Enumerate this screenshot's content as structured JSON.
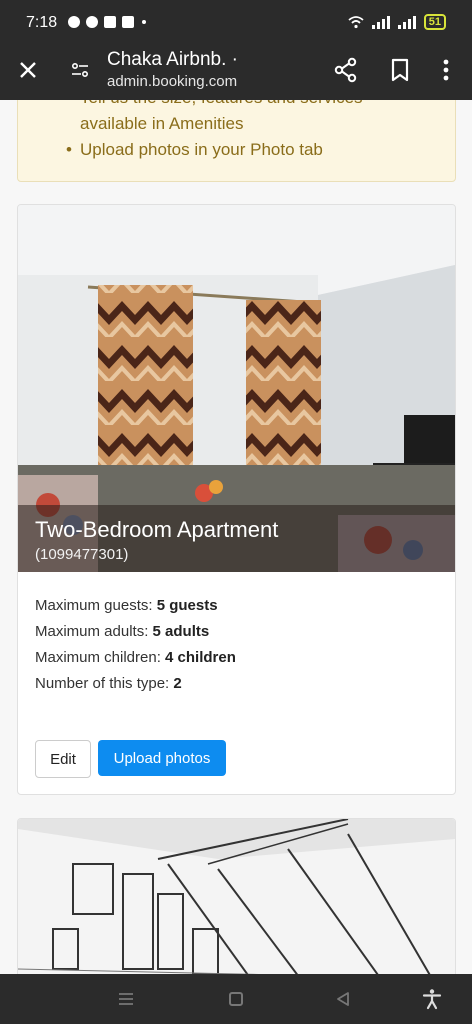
{
  "status_bar": {
    "time": "7:18",
    "battery": "51",
    "notification_icons": [
      "messenger-icon",
      "messenger-icon",
      "calendar-icon",
      "youtube-icon"
    ]
  },
  "browser": {
    "title": "Chaka Airbnb. ·",
    "url": "admin.booking.com"
  },
  "tips": {
    "items": [
      "Tell us the size, features and services",
      "available in Amenities",
      "Upload photos in your Photo tab"
    ]
  },
  "room": {
    "name": "Two-Bedroom Apartment",
    "id": "(1099477301)",
    "specs": [
      {
        "label": "Maximum guests: ",
        "value": "5 guests"
      },
      {
        "label": "Maximum adults: ",
        "value": "5 adults"
      },
      {
        "label": "Maximum children: ",
        "value": "4 children"
      },
      {
        "label": "Number of this type: ",
        "value": "2"
      }
    ],
    "edit_label": "Edit",
    "upload_label": "Upload photos"
  },
  "colors": {
    "primary_button": "#0d8cf0",
    "tip_background": "#fcf6e1",
    "tip_text": "#8a6d1a",
    "chrome": "#2b2b2b"
  }
}
